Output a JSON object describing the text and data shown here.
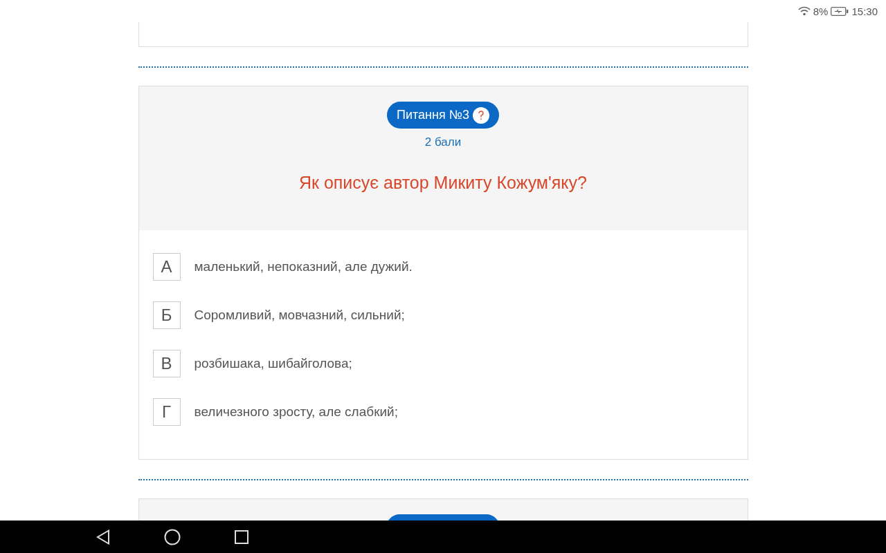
{
  "status_bar": {
    "battery": "8%",
    "time": "15:30"
  },
  "question": {
    "badge": "Питання №3",
    "points": "2 бали",
    "text": "Як описує автор Микиту Кожум'яку?",
    "options": [
      {
        "letter": "А",
        "text": "маленький, непоказний, але дужий.",
        "selected": false
      },
      {
        "letter": "Б",
        "text": "Соромливий, мовчазний, сильний;",
        "selected": false
      },
      {
        "letter": "В",
        "text": "розбишака, шибайголова;",
        "selected": false
      },
      {
        "letter": "Г",
        "text": "величезного зросту, але слабкий;",
        "selected": false
      }
    ]
  }
}
